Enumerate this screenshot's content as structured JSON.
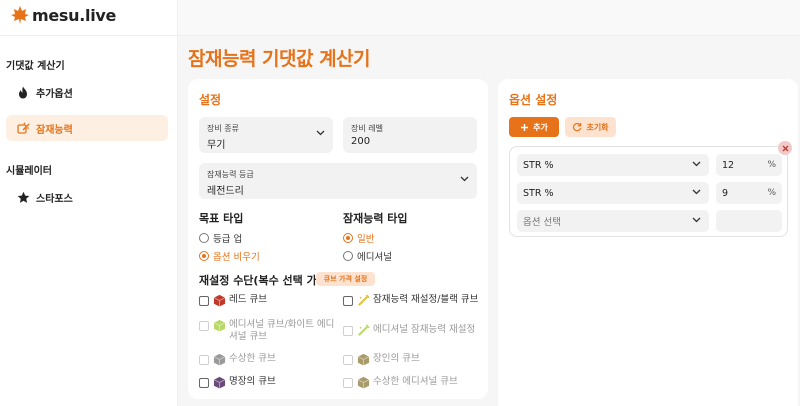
{
  "app": {
    "logo_text": "mesu.live"
  },
  "sidebar": {
    "section_calc": "기댓값 계산기",
    "item_additional": "추가옵션",
    "item_potential": "잠재능력",
    "section_sim": "시뮬레이터",
    "item_starforce": "스타포스"
  },
  "page": {
    "title": "잠재능력 기댓값 계산기"
  },
  "settings": {
    "title": "설정",
    "equip_type_label": "장비 종류",
    "equip_type_value": "무기",
    "equip_level_label": "장비 레벨",
    "equip_level_value": "200",
    "grade_label": "잠재능력 등급",
    "grade_value": "레전드리",
    "goal_title": "목표 타입",
    "goal_options": [
      "등급 업",
      "옵션 비우기"
    ],
    "goal_selected": "옵션 비우기",
    "potential_type_title": "잠재능력 타입",
    "potential_type_options": [
      "일반",
      "에디셔널"
    ],
    "potential_type_selected": "일반",
    "reset_title": "재설정 수단(복수 선택 가능)",
    "cube_price_label": "큐브 가격 설정",
    "cubes": [
      {
        "label": "레드 큐브",
        "enabled": true,
        "color": "#c0392b"
      },
      {
        "label": "잠재능력 재설정/블랙 큐브",
        "enabled": true,
        "color": "#e2c23a"
      },
      {
        "label": "에디셔널 큐브/화이트 에디셔널 큐브",
        "enabled": false,
        "color": "#b8d86a"
      },
      {
        "label": "에디셔널 잠재능력 재설정",
        "enabled": false,
        "color": "#b8d86a"
      },
      {
        "label": "수상한 큐브",
        "enabled": false,
        "color": "#9a9a9a"
      },
      {
        "label": "장인의 큐브",
        "enabled": false,
        "color": "#a99a6a"
      },
      {
        "label": "명장의 큐브",
        "enabled": true,
        "color": "#6b4a7a"
      },
      {
        "label": "수상한 에디셔널 큐브",
        "enabled": false,
        "color": "#a99a6a"
      }
    ]
  },
  "options": {
    "title": "옵션 설정",
    "add_label": "추가",
    "reset_label": "초기화",
    "rows": [
      {
        "stat": "STR %",
        "value": "12",
        "unit": "%"
      },
      {
        "stat": "STR %",
        "value": "9",
        "unit": "%"
      },
      {
        "stat": "옵션 선택",
        "value": "",
        "unit": ""
      }
    ]
  },
  "colors": {
    "accent": "#e6731a",
    "accent_light": "#fde3cf"
  }
}
